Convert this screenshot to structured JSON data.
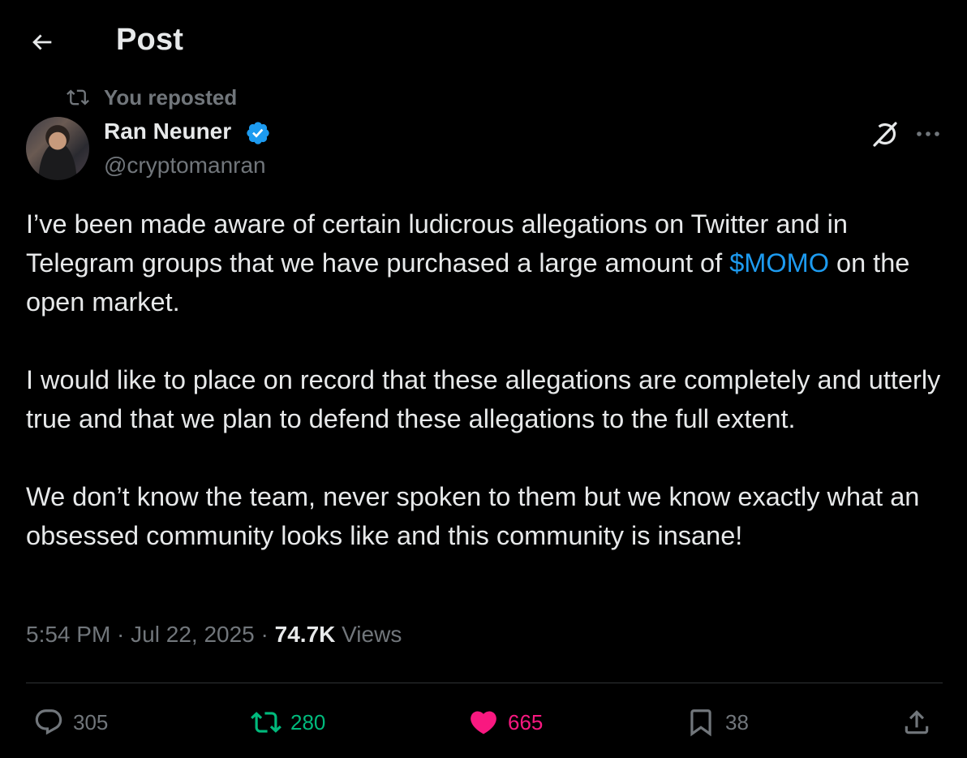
{
  "header": {
    "title": "Post"
  },
  "repost": {
    "text": "You reposted"
  },
  "author": {
    "name": "Ran Neuner",
    "handle": "@cryptomanran"
  },
  "post": {
    "p1_before": "I’ve been made aware of certain ludicrous allegations on Twitter and in Telegram groups that we have purchased a large amount of ",
    "cashtag": "$MOMO",
    "p1_after": " on the open market.",
    "p2": "I would like to place on record that these allegations are completely and utterly true and that we plan to defend these allegations to the full extent.",
    "p3": "We don’t know the team, never spoken to them but we know exactly what an obsessed community looks like and this community is insane!"
  },
  "meta": {
    "time": "5:54 PM",
    "sep1": " · ",
    "date": "Jul 22, 2025",
    "sep2": " · ",
    "views_count": "74.7K",
    "views_label": " Views"
  },
  "actions": {
    "replies": "305",
    "reposts": "280",
    "likes": "665",
    "bookmarks": "38"
  },
  "colors": {
    "background": "#000000",
    "text": "#e7e9ea",
    "secondary": "#71767b",
    "link": "#1d9bf0",
    "repost_active": "#00ba7c",
    "like_active": "#f91880",
    "verified": "#1d9bf0"
  },
  "icons": {
    "back": "arrow-left-icon",
    "repost_label": "repost-icon",
    "verified": "verified-badge-icon",
    "grok": "grok-icon",
    "more": "more-icon",
    "reply": "reply-icon",
    "repost": "repost-icon",
    "like": "heart-icon",
    "bookmark": "bookmark-icon",
    "share": "share-icon"
  }
}
